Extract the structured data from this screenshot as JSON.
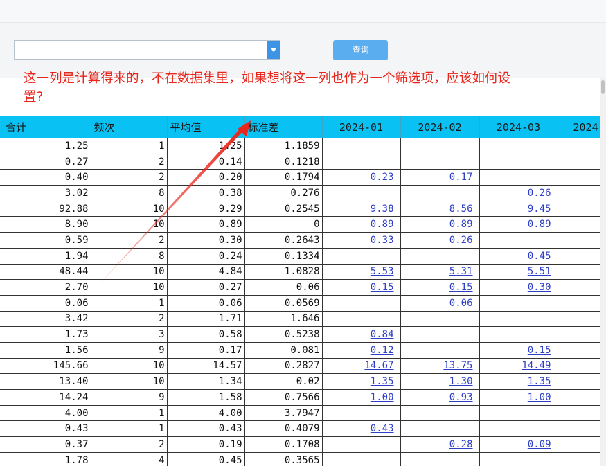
{
  "filter": {
    "select_value": "",
    "query_button": "查询"
  },
  "annotation": {
    "question_line1": "这一列是计算得来的，不在数据集里，如果想将这一列也作为一个筛选项，应该如何设",
    "question_line2": "置?",
    "arrow_color": "#e8261c"
  },
  "table": {
    "headers": [
      "合计",
      "频次",
      "平均值",
      "标准差",
      "2024-01",
      "2024-02",
      "2024-03",
      "2024"
    ],
    "header_bg": "#0ac1f3",
    "link_color": "#2e3fc7",
    "rows": [
      [
        "1.25",
        "1",
        "1.25",
        "1.1859",
        "",
        "",
        "",
        ""
      ],
      [
        "0.27",
        "2",
        "0.14",
        "0.1218",
        "",
        "",
        "",
        ""
      ],
      [
        "0.40",
        "2",
        "0.20",
        "0.1794",
        "0.23",
        "0.17",
        "",
        ""
      ],
      [
        "3.02",
        "8",
        "0.38",
        "0.276",
        "",
        "",
        "0.26",
        ""
      ],
      [
        "92.88",
        "10",
        "9.29",
        "0.2545",
        "9.38",
        "8.56",
        "9.45",
        ""
      ],
      [
        "8.90",
        "10",
        "0.89",
        "0",
        "0.89",
        "0.89",
        "0.89",
        ""
      ],
      [
        "0.59",
        "2",
        "0.30",
        "0.2643",
        "0.33",
        "0.26",
        "",
        ""
      ],
      [
        "1.94",
        "8",
        "0.24",
        "0.1334",
        "",
        "",
        "0.45",
        ""
      ],
      [
        "48.44",
        "10",
        "4.84",
        "1.0828",
        "5.53",
        "5.31",
        "5.51",
        ""
      ],
      [
        "2.70",
        "10",
        "0.27",
        "0.06",
        "0.15",
        "0.15",
        "0.30",
        ""
      ],
      [
        "0.06",
        "1",
        "0.06",
        "0.0569",
        "",
        "0.06",
        "",
        ""
      ],
      [
        "3.42",
        "2",
        "1.71",
        "1.646",
        "",
        "",
        "",
        ""
      ],
      [
        "1.73",
        "3",
        "0.58",
        "0.5238",
        "0.84",
        "",
        "",
        ""
      ],
      [
        "1.56",
        "9",
        "0.17",
        "0.081",
        "0.12",
        "",
        "0.15",
        ""
      ],
      [
        "145.66",
        "10",
        "14.57",
        "0.2827",
        "14.67",
        "13.75",
        "14.49",
        ""
      ],
      [
        "13.40",
        "10",
        "1.34",
        "0.02",
        "1.35",
        "1.30",
        "1.35",
        ""
      ],
      [
        "14.24",
        "9",
        "1.58",
        "0.7566",
        "1.00",
        "0.93",
        "1.00",
        ""
      ],
      [
        "4.00",
        "1",
        "4.00",
        "3.7947",
        "",
        "",
        "",
        ""
      ],
      [
        "0.43",
        "1",
        "0.43",
        "0.4079",
        "0.43",
        "",
        "",
        ""
      ],
      [
        "0.37",
        "2",
        "0.19",
        "0.1708",
        "",
        "0.28",
        "0.09",
        ""
      ],
      [
        "1.78",
        "4",
        "0.45",
        "0.3565",
        "",
        "",
        "",
        ""
      ]
    ]
  }
}
